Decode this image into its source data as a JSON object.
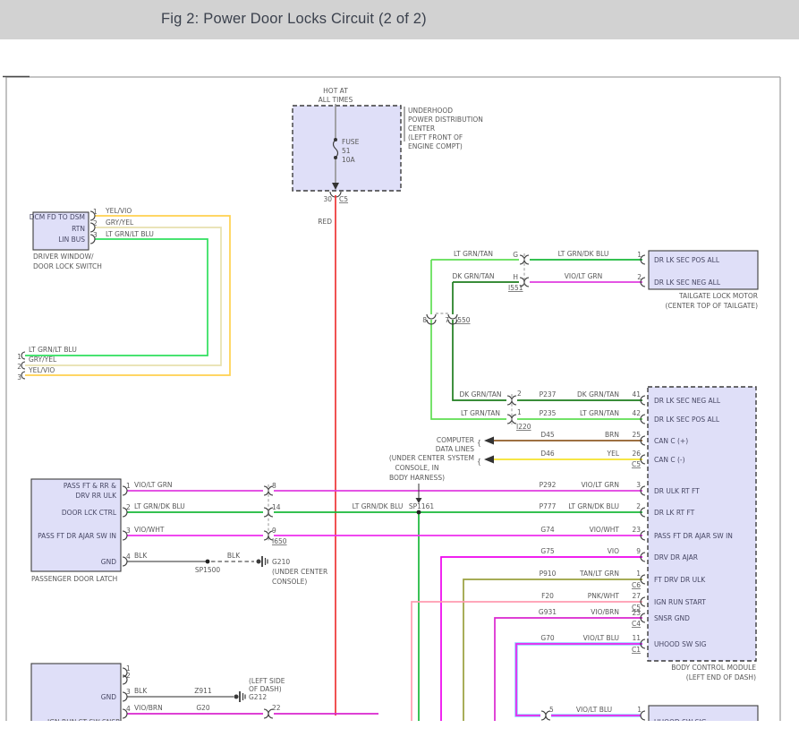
{
  "title": "Fig 2: Power Door Locks Circuit (2 of 2)",
  "colors": {
    "header_bg": "#d2d2d2",
    "box_fill": "#dfdff8",
    "box_border": "#3c3c3c",
    "frame": "#a2a2a2",
    "text": "#585858",
    "box_text": "#474764",
    "red": "#ee3333",
    "gray_wire": "#8d8d8d",
    "blk": "#707070",
    "yel_vio": "#ffd14e",
    "gry_yel": "#e7e1ae",
    "lt_grn_lt_blu": "#2fdf5d",
    "lt_grn_tan": "#5ede52",
    "dk_grn_tan": "#1e7d1e",
    "lt_grn_dk_blu": "#18b838",
    "vio_lt_grn": "#e03ce0",
    "vio_wht": "#ee2dee",
    "vio": "#ee00ee",
    "tan_lt_grn": "#9aa03e",
    "pnk_wht": "#ff9bb0",
    "vio_brn": "#da25cf",
    "vio_lt_blu": "#ee22ee",
    "lt_blu": "#8ad2ff",
    "brn": "#8f5c26",
    "yel": "#f4e32c"
  },
  "power": {
    "hot1": "HOT AT",
    "hot2": "ALL TIMES",
    "fuse": "FUSE",
    "fuse_num": "51",
    "fuse_amp": "10A",
    "pin": "30",
    "conn": "C5",
    "wire": "RED",
    "name1": "UNDERHOOD",
    "name2": "POWER DISTRIBUTION",
    "name3": "CENTER",
    "name4": "(LEFT FRONT OF",
    "name5": "ENGINE COMPT)"
  },
  "driver_switch": {
    "name1": "DRIVER WINDOW/",
    "name2": "DOOR LOCK SWITCH",
    "p1": "1",
    "p2": "2",
    "p3": "3",
    "l1": "DCM FD TO DSM",
    "l2": "RTN",
    "l3": "LIN BUS",
    "w1": "YEL/VIO",
    "w2": "GRY/YEL",
    "w3": "LT GRN/LT BLU",
    "s1n": "1",
    "s1w": "LT GRN/LT BLU",
    "s2n": "2",
    "s2w": "GRY/YEL",
    "s3n": "3",
    "s3w": "YEL/VIO"
  },
  "tailgate": {
    "name1": "TAILGATE LOCK MOTOR",
    "name2": "(CENTER TOP OF TAILGATE)",
    "w1l": "LT GRN/TAN",
    "c1": "G",
    "w1r": "LT GRN/DK BLU",
    "p1": "1",
    "l1": "DR LK SEC POS ALL",
    "w2l": "DK GRN/TAN",
    "c2": "H",
    "cname": "I551",
    "w2r": "VIO/LT GRN",
    "p2": "2",
    "l2": "DR LK SEC NEG ALL"
  },
  "i550": {
    "pl": "8",
    "pr": "7",
    "name": "I550"
  },
  "i220": {
    "name": "I220",
    "r1wl": "DK GRN/TAN",
    "r1p": "2",
    "r1c": "P237",
    "r1wr": "DK GRN/TAN",
    "r1pin": "41",
    "r2wl": "LT GRN/TAN",
    "r2p": "1",
    "r2c": "P235",
    "r2wr": "LT GRN/TAN",
    "r2pin": "42"
  },
  "data_lines": {
    "t1": "COMPUTER",
    "t2": "DATA LINES",
    "t3": "SYSTEM",
    "brace": "{",
    "r1c": "D45",
    "r1w": "BRN",
    "r1pin": "25",
    "r2c": "D46",
    "r2w": "YEL",
    "r2pin": "26",
    "r2conn": "C5"
  },
  "bcm": {
    "name1": "BODY CONTROL MODULE",
    "name2": "(LEFT END OF DASH)",
    "l41": "DR LK SEC NEG ALL",
    "l42": "DR LK SEC POS ALL",
    "l25": "CAN C (+)",
    "l26": "CAN C (-)",
    "l3": "DR ULK RT FT",
    "l2": "DR LK RT FT",
    "l23": "PASS FT DR AJAR SW IN",
    "l9": "DRV DR AJAR",
    "l1": "FT DRV DR ULK",
    "l27": "IGN RUN START",
    "l23b": "SNSR GND",
    "l11": "UHOOD SW SIG"
  },
  "rows": {
    "r1": {
      "c": "P292",
      "w": "VIO/LT GRN",
      "pin": "3"
    },
    "r2": {
      "c": "P777",
      "w": "LT GRN/DK BLU",
      "pin": "2"
    },
    "r3": {
      "c": "G74",
      "w": "VIO/WHT",
      "pin": "23"
    },
    "r4": {
      "c": "G75",
      "w": "VIO",
      "pin": "9"
    },
    "r5": {
      "c": "P910",
      "w": "TAN/LT GRN",
      "pin": "1",
      "conn": "C6"
    },
    "r6": {
      "c": "F20",
      "w": "PNK/WHT",
      "pin": "27",
      "conn": "C5"
    },
    "r7": {
      "c": "G931",
      "w": "VIO/BRN",
      "pin": "23",
      "conn": "C4"
    },
    "r8": {
      "c": "G70",
      "w": "VIO/LT BLU",
      "pin": "11",
      "conn": "C1"
    }
  },
  "latch": {
    "name": "PASSENGER DOOR LATCH",
    "p1": "1",
    "l1a": "PASS FT & RR &",
    "l1b": "DRV RR ULK",
    "w1": "VIO/LT GRN",
    "c1": "8",
    "p2": "2",
    "l2": "DOOR LCK CTRL",
    "w2": "LT GRN/DK BLU",
    "c2": "14",
    "p3": "3",
    "l3": "PASS FT DR AJAR SW IN",
    "w3": "VIO/WHT",
    "c3": "9",
    "cname": "I650",
    "p4": "4",
    "l4": "GND",
    "w4": "BLK",
    "splice": "SP1500",
    "w4b": "BLK",
    "gnd": "G210",
    "gl1": "(UNDER CENTER",
    "gl2": "CONSOLE)"
  },
  "mid": {
    "n1": "(UNDER CENTER",
    "n2": "CONSOLE, IN",
    "n3": "BODY HARNESS)",
    "splice": "SP1161",
    "w": "LT GRN/DK BLU"
  },
  "bottom_box": {
    "name": "IGN RUN ST SW SNSR",
    "p1": "1",
    "p2": "2",
    "p3": "3",
    "l3": "GND",
    "p4": "4",
    "w3": "BLK",
    "c3": "Z911",
    "gnd": "G212",
    "gl1": "(LEFT SIDE",
    "gl2": "OF DASH)",
    "w4": "VIO/BRN",
    "c4": "G20",
    "conn4": "22"
  },
  "uhood": {
    "conn": "5",
    "w": "VIO/LT BLU",
    "pin": "1",
    "name": "UHOOD SW SIG"
  }
}
